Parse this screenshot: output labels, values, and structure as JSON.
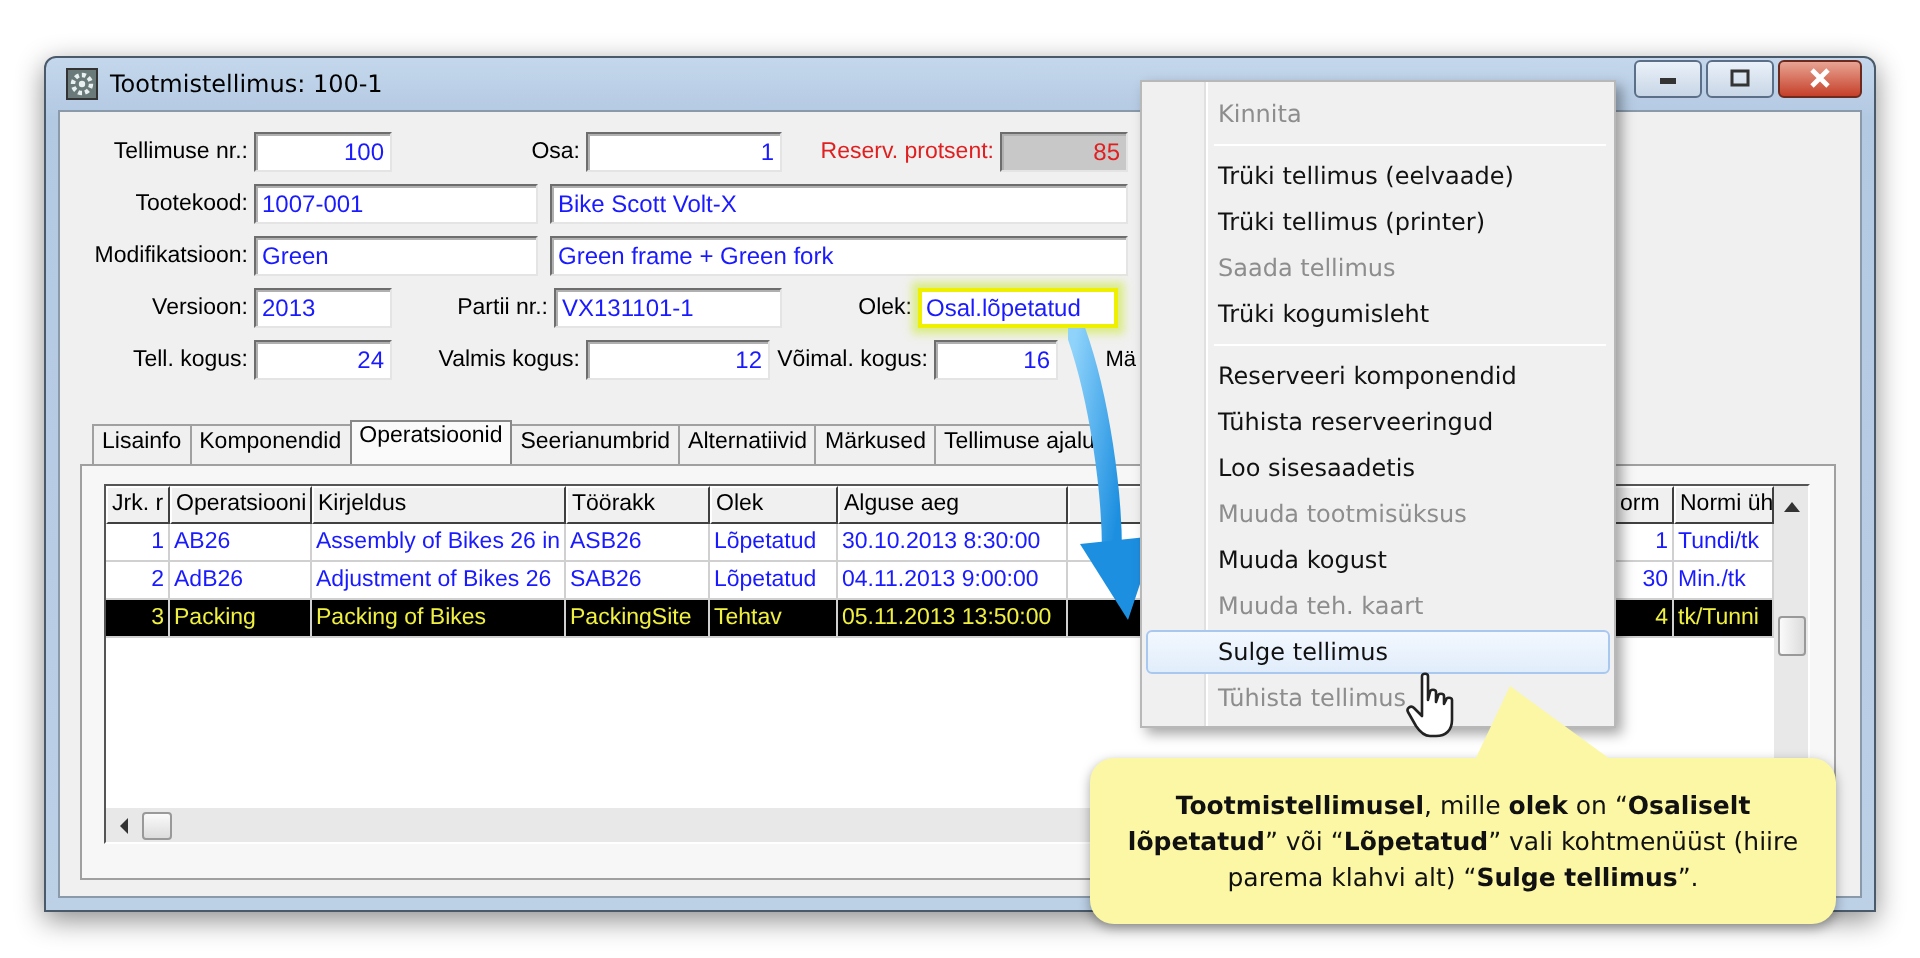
{
  "window": {
    "title": "Tootmistellimus: 100-1"
  },
  "form": {
    "rows": [
      [
        {
          "label": "Tellimuse nr.:",
          "value": "100",
          "kind": "number"
        },
        {
          "label": "Osa:",
          "value": "1",
          "kind": "number"
        },
        {
          "label": "Reserv. protsent:",
          "value": "85",
          "kind": "number",
          "alert": true,
          "readonly": true
        }
      ],
      [
        {
          "label": "Tootekood:",
          "value": "1007-001",
          "kind": "text"
        },
        {
          "value": "Bike Scott Volt-X",
          "kind": "text"
        }
      ],
      [
        {
          "label": "Modifikatsioon:",
          "value": "Green",
          "kind": "text"
        },
        {
          "value": "Green frame + Green fork",
          "kind": "text"
        }
      ],
      [
        {
          "label": "Versioon:",
          "value": "2013",
          "kind": "text"
        },
        {
          "label": "Partii nr.:",
          "value": "VX131101-1",
          "kind": "text"
        },
        {
          "label": "Olek:",
          "value": "Osal.lõpetatud",
          "kind": "text",
          "highlighted": true
        }
      ],
      [
        {
          "label": "Tell. kogus:",
          "value": "24",
          "kind": "number"
        },
        {
          "label": "Valmis kogus:",
          "value": "12",
          "kind": "number"
        },
        {
          "label": "Võimal. kogus:",
          "value": "16",
          "kind": "number"
        },
        {
          "label": "Mä"
        }
      ]
    ]
  },
  "tabs": [
    {
      "label": "Lisainfo",
      "selected": false
    },
    {
      "label": "Komponendid",
      "selected": false
    },
    {
      "label": "Operatsioonid",
      "selected": true
    },
    {
      "label": "Seerianumbrid",
      "selected": false
    },
    {
      "label": "Alternatiivid",
      "selected": false
    },
    {
      "label": "Märkused",
      "selected": false
    },
    {
      "label": "Tellimuse ajalu",
      "selected": false
    }
  ],
  "table": {
    "columns": [
      {
        "label": "Jrk. r",
        "kind": "number"
      },
      {
        "label": "Operatsiooni",
        "kind": "text"
      },
      {
        "label": "Kirjeldus",
        "kind": "text"
      },
      {
        "label": "Töörakk",
        "kind": "text"
      },
      {
        "label": "Olek",
        "kind": "text"
      },
      {
        "label": "Alguse aeg",
        "kind": "text"
      },
      {
        "label": "orm",
        "kind": "number"
      },
      {
        "label": "Normi üh",
        "kind": "text"
      }
    ],
    "rows": [
      {
        "selected": false,
        "cells": [
          "1",
          "AB26",
          "Assembly of Bikes 26 in",
          "ASB26",
          "Lõpetatud",
          "30.10.2013 8:30:00",
          "1",
          "Tundi/tk"
        ]
      },
      {
        "selected": false,
        "cells": [
          "2",
          "AdB26",
          "Adjustment of Bikes 26",
          "SAB26",
          "Lõpetatud",
          "04.11.2013 9:00:00",
          "30",
          "Min./tk"
        ]
      },
      {
        "selected": true,
        "cells": [
          "3",
          "Packing",
          "Packing of Bikes",
          "PackingSite",
          "Tehtav",
          "05.11.2013 13:50:00",
          "4",
          "tk/Tunni"
        ]
      }
    ]
  },
  "context_menu": {
    "items": [
      {
        "kind": "item",
        "label": "Kinnita",
        "disabled": true,
        "selected": false
      },
      {
        "kind": "separator"
      },
      {
        "kind": "item",
        "label": "Trüki tellimus (eelvaade)",
        "disabled": false,
        "selected": false
      },
      {
        "kind": "item",
        "label": "Trüki tellimus (printer)",
        "disabled": false,
        "selected": false
      },
      {
        "kind": "item",
        "label": "Saada tellimus",
        "disabled": true,
        "selected": false
      },
      {
        "kind": "item",
        "label": "Trüki kogumisleht",
        "disabled": false,
        "selected": false
      },
      {
        "kind": "separator"
      },
      {
        "kind": "item",
        "label": "Reserveeri komponendid",
        "disabled": false,
        "selected": false
      },
      {
        "kind": "item",
        "label": "Tühista reserveeringud",
        "disabled": false,
        "selected": false
      },
      {
        "kind": "item",
        "label": "Loo sisesaadetis",
        "disabled": false,
        "selected": false
      },
      {
        "kind": "item",
        "label": "Muuda tootmisüksus",
        "disabled": true,
        "selected": false
      },
      {
        "kind": "item",
        "label": "Muuda kogust",
        "disabled": false,
        "selected": false
      },
      {
        "kind": "item",
        "label": "Muuda teh. kaart",
        "disabled": true,
        "selected": false
      },
      {
        "kind": "item",
        "label": "Sulge tellimus",
        "disabled": false,
        "selected": true
      },
      {
        "kind": "item",
        "label": "Tühista tellimus",
        "disabled": true,
        "selected": false
      }
    ]
  },
  "callout": {
    "text": "**Tootmistellimusel**, mille **olek** on “**Osaliselt lõpetatud**” või “**Lõpetatud**” vali kohtmenüüst (hiire parema klahvi alt) “**Sulge tellimus**”."
  }
}
